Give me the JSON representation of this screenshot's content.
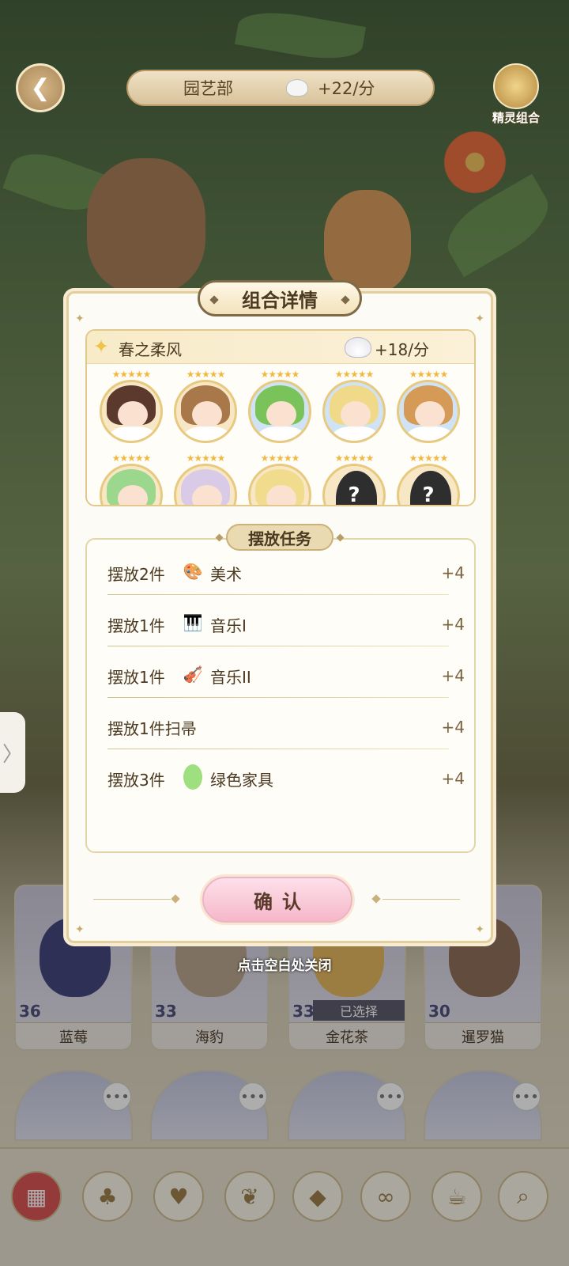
{
  "header": {
    "club_name": "园艺部",
    "rate": "+22/分",
    "elf_combo_label": "精灵组合"
  },
  "modal": {
    "title": "组合详情",
    "combo": {
      "name": "春之柔风",
      "rate": "+18/分",
      "characters": [
        {
          "id": "c1",
          "hair_color": "#5b3a2d",
          "bg": "#f7e7c5",
          "unknown": false
        },
        {
          "id": "c2",
          "hair_color": "#a8774a",
          "bg": "#f7e7c5",
          "unknown": false
        },
        {
          "id": "c3",
          "hair_color": "#7ac35b",
          "bg": "#cfe3f5",
          "unknown": false
        },
        {
          "id": "c4",
          "hair_color": "#f1d98a",
          "bg": "#cfe3f5",
          "unknown": false
        },
        {
          "id": "c5",
          "hair_color": "#d59a55",
          "bg": "#cfe3f5",
          "unknown": false
        },
        {
          "id": "c6",
          "hair_color": "#9bd78c",
          "bg": "#f7e7c5",
          "unknown": false
        },
        {
          "id": "c7",
          "hair_color": "#d9cbe7",
          "bg": "#f7e7c5",
          "unknown": false
        },
        {
          "id": "c8",
          "hair_color": "#f1dc8d",
          "bg": "#f7e7c5",
          "unknown": false
        },
        {
          "id": "c9",
          "hair_color": "#2e2e2e",
          "bg": "#f7e7c5",
          "unknown": true,
          "mark": "?"
        },
        {
          "id": "c10",
          "hair_color": "#2e2e2e",
          "bg": "#f7e7c5",
          "unknown": true,
          "mark": "?"
        }
      ]
    },
    "tasks_label": "摆放任务",
    "tasks": [
      {
        "text": "摆放2件",
        "icon": "palette-icon",
        "category": "美术",
        "points": "+4"
      },
      {
        "text": "摆放1件",
        "icon": "piano-icon",
        "category": "音乐I",
        "points": "+4"
      },
      {
        "text": "摆放1件",
        "icon": "violin-icon",
        "category": "音乐II",
        "points": "+4"
      },
      {
        "text": "摆放1件扫帚",
        "icon": "",
        "category": "",
        "points": "+4"
      },
      {
        "text": "摆放3件",
        "icon": "green-dot-icon",
        "category": "绿色家具",
        "points": "+4"
      }
    ],
    "confirm_label": "确认"
  },
  "close_hint": "点击空白处关闭",
  "roster": [
    {
      "name": "蓝莓",
      "level": "36",
      "selected": false
    },
    {
      "name": "海豹",
      "level": "33",
      "selected": false
    },
    {
      "name": "金花茶",
      "level": "33",
      "selected": true,
      "selected_label": "已选择"
    },
    {
      "name": "暹罗猫",
      "level": "30",
      "selected": false
    }
  ],
  "colors": {
    "accent_gold": "#e3cf9e",
    "text_brown": "#4b3a21",
    "confirm_pink": "#f6b7c9",
    "green_furniture": "#9ee07f"
  }
}
